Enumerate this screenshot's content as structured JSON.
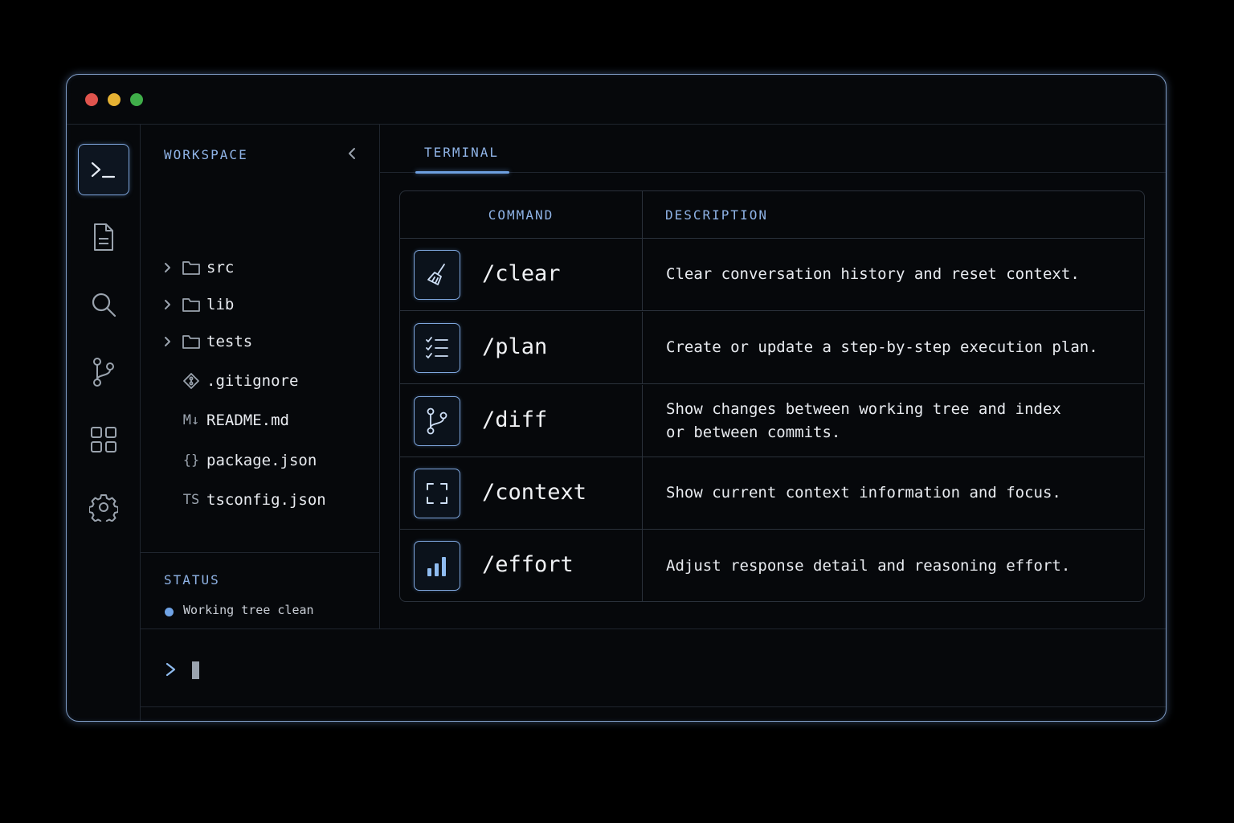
{
  "window": {
    "traffic_lights": [
      "#e0544d",
      "#e6b233",
      "#3fae49"
    ]
  },
  "activity_bar": {
    "items": [
      {
        "icon": "terminal-icon",
        "active": true
      },
      {
        "icon": "file-icon",
        "active": false
      },
      {
        "icon": "search-icon",
        "active": false
      },
      {
        "icon": "git-branch-icon",
        "active": false
      },
      {
        "icon": "grid-icon",
        "active": false
      },
      {
        "icon": "gear-icon",
        "active": false
      }
    ]
  },
  "sidebar": {
    "title": "WORKSPACE",
    "items": [
      {
        "name": "src",
        "icon": "folder-icon",
        "expandable": true
      },
      {
        "name": "lib",
        "icon": "folder-icon",
        "expandable": true
      },
      {
        "name": "tests",
        "icon": "folder-icon",
        "expandable": true
      },
      {
        "name": ".gitignore",
        "icon": "git-file-icon",
        "expandable": false
      },
      {
        "name": "README.md",
        "icon": "markdown-icon",
        "icon_text": "M↓",
        "expandable": false
      },
      {
        "name": "package.json",
        "icon": "json-icon",
        "icon_text": "{}",
        "expandable": false
      },
      {
        "name": "tsconfig.json",
        "icon": "typescript-icon",
        "icon_text": "TS",
        "expandable": false
      }
    ]
  },
  "status": {
    "title": "STATUS",
    "text": "Working tree clean",
    "dot_color": "#6fa3e6"
  },
  "main": {
    "tab": "TERMINAL",
    "table": {
      "headers": {
        "command": "COMMAND",
        "description": "DESCRIPTION"
      },
      "rows": [
        {
          "command": "/clear",
          "icon": "broom-icon",
          "description": "Clear conversation history and reset context."
        },
        {
          "command": "/plan",
          "icon": "checklist-icon",
          "description": "Create or update a step-by-step execution plan."
        },
        {
          "command": "/diff",
          "icon": "git-branch-icon",
          "description": "Show changes between working tree and index\nor between commits."
        },
        {
          "command": "/context",
          "icon": "focus-frame-icon",
          "description": "Show current context information and focus."
        },
        {
          "command": "/effort",
          "icon": "bar-chart-icon",
          "description": "Adjust response detail and reasoning effort."
        }
      ]
    }
  },
  "prompt": {
    "symbol": ">",
    "value": ""
  },
  "colors": {
    "accent": "#7ea6dd",
    "heading": "#8fb3e6",
    "background": "#06080b"
  }
}
